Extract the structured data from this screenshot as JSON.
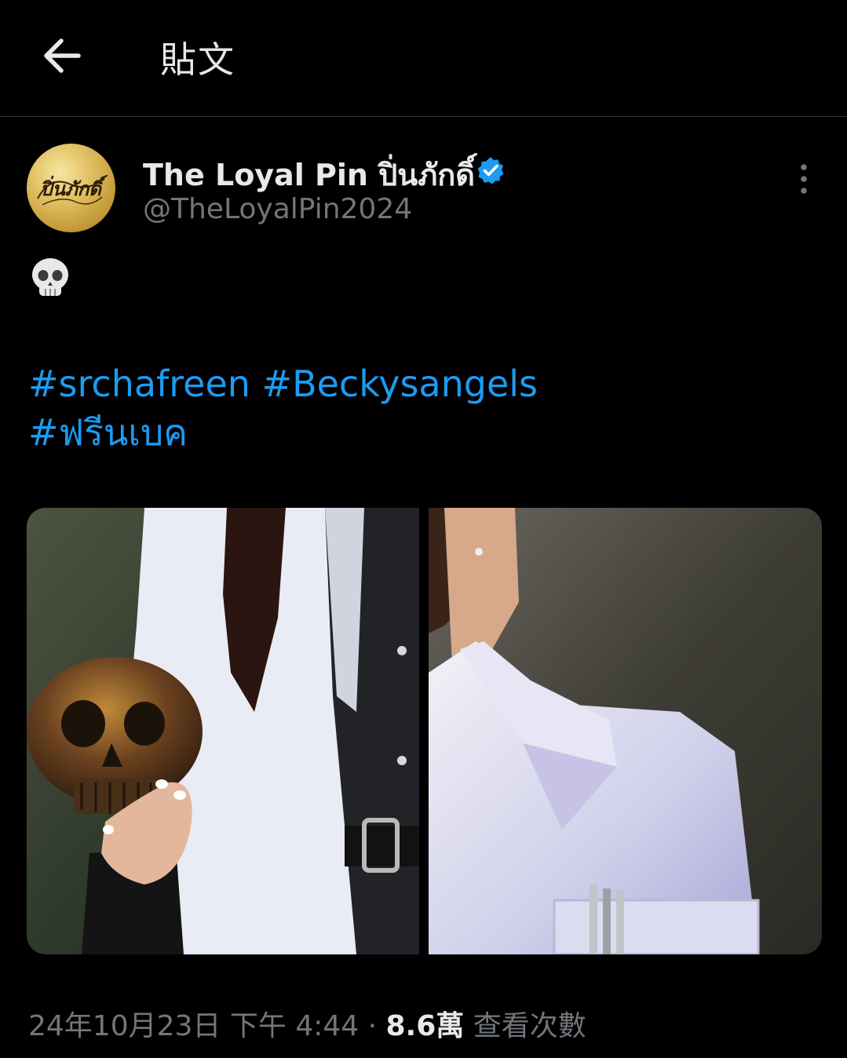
{
  "header": {
    "title": "貼文",
    "back_icon": "arrow-left-icon"
  },
  "post": {
    "author_name": "The Loyal Pin ปิ่นภักดิ์",
    "handle": "@TheLoyalPin2024",
    "verified": true,
    "avatar_logo_text": "ปิ่นภักดิ์",
    "emoji": "skull-emoji",
    "hashtags": [
      "#srchafreen",
      "#Beckysangels",
      "#ฟรีนเบค"
    ],
    "images": [
      {
        "description_icon": "photo-skull-in-hand"
      },
      {
        "description_icon": "photo-lab-coat-collar"
      }
    ],
    "timestamp": "24年10月23日 下午 4:44",
    "separator": " · ",
    "views_count": "8.6萬",
    "views_label": " 查看次數"
  },
  "colors": {
    "background": "#000000",
    "text": "#e7e9ea",
    "muted": "#71767b",
    "accent": "#1d9bf0",
    "divider": "#2f3336"
  }
}
